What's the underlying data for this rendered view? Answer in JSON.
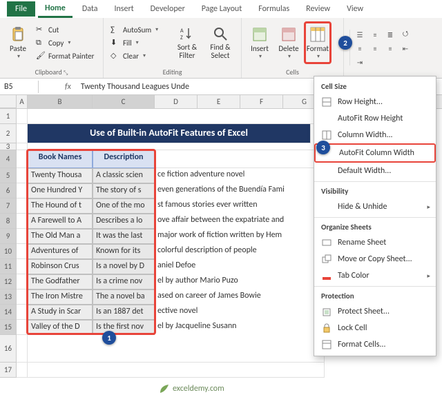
{
  "tabs": {
    "file": "File",
    "home": "Home",
    "data": "Data",
    "insert": "Insert",
    "developer": "Developer",
    "pagelayout": "Page Layout",
    "formulas": "Formulas",
    "review": "Review",
    "view": "View"
  },
  "ribbon": {
    "paste": "Paste",
    "cut": "Cut",
    "copy": "Copy",
    "format_painter": "Format Painter",
    "clipboard": "Clipboard",
    "autosum": "AutoSum",
    "fill": "Fill",
    "clear": "Clear",
    "sort_filter": "Sort &\nFilter",
    "find_select": "Find &\nSelect",
    "editing": "Editing",
    "insert_btn": "Insert",
    "delete_btn": "Delete",
    "format_btn": "Format",
    "cells": "Cells"
  },
  "namebox": "B5",
  "formula": "Twenty Thousand Leagues Unde",
  "col_headers": [
    "A",
    "B",
    "C",
    "D",
    "E",
    "F",
    "G"
  ],
  "row_numbers": [
    "1",
    "2",
    "3",
    "4",
    "5",
    "6",
    "7",
    "8",
    "9",
    "10",
    "11",
    "12",
    "13",
    "14",
    "15",
    "16",
    "17"
  ],
  "sheet": {
    "title": "Use of Built-in AutoFit Features of Excel",
    "h1": "Book Names",
    "h2": "Description",
    "rows": [
      {
        "b": "Twenty Thousa",
        "c": "A classic scien",
        "rest": "ce fiction adventure novel"
      },
      {
        "b": "One Hundred Y",
        "c": "The story of s",
        "rest": "even generations of the Buendía Fami"
      },
      {
        "b": "The Hound of t",
        "c": "One of the mo",
        "rest": "st famous stories ever written"
      },
      {
        "b": "A Farewell to A",
        "c": "Describes a lo",
        "rest": "ove affair between the expatriate and"
      },
      {
        "b": "The Old Man a",
        "c": "It was the last",
        "rest": " major work of fiction written by Hem"
      },
      {
        "b": "Adventures of",
        "c": "Known for its",
        "rest": " colorful description of people"
      },
      {
        "b": "Robinson Crus",
        "c": "Is a novel by D",
        "rest": "aniel Defoe"
      },
      {
        "b": "The Godfather",
        "c": "Is a crime nov",
        "rest": "el by author Mario Puzo"
      },
      {
        "b": "The Iron Mistre",
        "c": "The a novel ba",
        "rest": "ased on career of James Bowie"
      },
      {
        "b": "A Study in Scar",
        "c": "Is an 1887 det",
        "rest": "ective novel"
      },
      {
        "b": "Valley of the D",
        "c": "Is the first nov",
        "rest": "el by Jacqueline Susann"
      }
    ]
  },
  "menu": {
    "cell_size": "Cell Size",
    "row_height": "Row Height...",
    "autofit_row": "AutoFit Row Height",
    "col_width": "Column Width...",
    "autofit_col": "AutoFit Column Width",
    "default_width": "Default Width...",
    "visibility": "Visibility",
    "hide_unhide": "Hide & Unhide",
    "organize": "Organize Sheets",
    "rename": "Rename Sheet",
    "move_copy": "Move or Copy Sheet...",
    "tab_color": "Tab Color",
    "protection": "Protection",
    "protect_sheet": "Protect Sheet...",
    "lock_cell": "Lock Cell",
    "format_cells": "Format Cells..."
  },
  "badges": {
    "b1": "1",
    "b2": "2",
    "b3": "3"
  },
  "watermark": "exceldemy.com"
}
